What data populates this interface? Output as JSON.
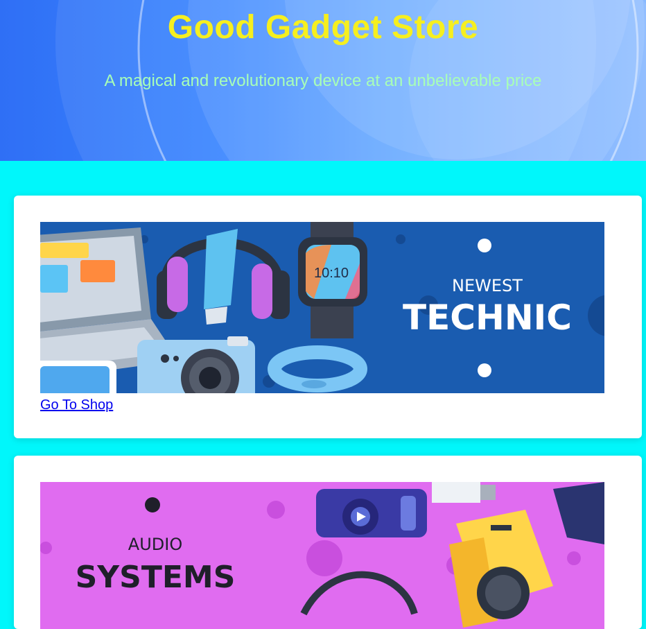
{
  "hero": {
    "title": "Good Gadget Store",
    "subtitle": "A magical and revolutionary device at an unbelievable price"
  },
  "cards": [
    {
      "banner_line1": "NEWEST",
      "banner_line2": "TECHNIC",
      "watch_time": "10:10",
      "link_label": "Go To Shop"
    },
    {
      "banner_line1": "AUDIO",
      "banner_line2": "SYSTEMS"
    }
  ],
  "colors": {
    "page_background": "#00f7fb",
    "hero_title": "#f6ef1f",
    "hero_subtitle": "#a8ffb6",
    "technic_banner": "#1a5cb0",
    "audio_banner": "#e06cf0",
    "link": "#0000ee"
  }
}
